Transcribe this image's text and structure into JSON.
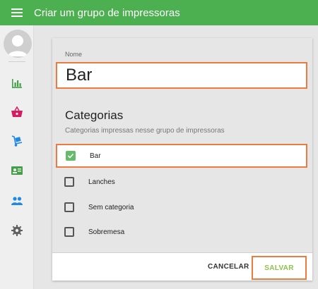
{
  "appbar": {
    "title": "Criar um grupo de impressoras"
  },
  "sidebar": {
    "items": [
      {
        "icon": "bar-chart-icon",
        "color": "#43a047"
      },
      {
        "icon": "basket-icon",
        "color": "#d81b60"
      },
      {
        "icon": "dolly-icon",
        "color": "#1e88e5"
      },
      {
        "icon": "id-card-icon",
        "color": "#43a047"
      },
      {
        "icon": "people-icon",
        "color": "#1e88e5"
      },
      {
        "icon": "gear-icon",
        "color": "#616161"
      }
    ]
  },
  "form": {
    "name_label": "Nome",
    "name_value": "Bar",
    "categories_title": "Categorias",
    "categories_subtitle": "Categorias impressas nesse grupo de impressoras",
    "categories": [
      {
        "label": "Bar",
        "checked": true
      },
      {
        "label": "Lanches",
        "checked": false
      },
      {
        "label": "Sem categoria",
        "checked": false
      },
      {
        "label": "Sobremesa",
        "checked": false
      }
    ]
  },
  "actions": {
    "cancel_label": "CANCELAR",
    "save_label": "SALVAR"
  },
  "colors": {
    "primary": "#4caf50",
    "highlight": "#ef7a3e",
    "accent": "#8bc34a"
  }
}
